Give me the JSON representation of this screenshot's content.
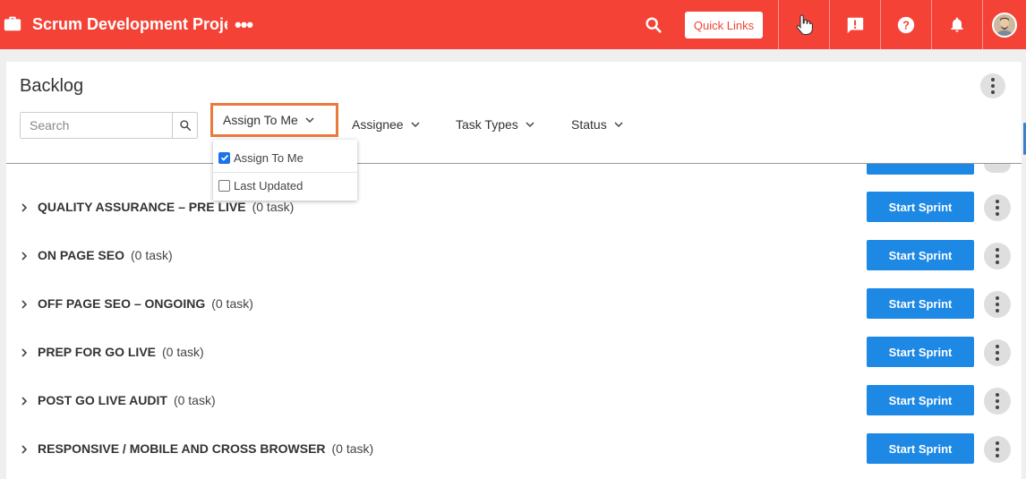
{
  "header": {
    "project_title": "Scrum Development Projec",
    "more": "•••",
    "quick_links": "Quick Links",
    "icons": [
      "briefcase-icon",
      "search-icon",
      "pointer-hand-icon",
      "feedback-icon",
      "help-icon",
      "bell-icon",
      "avatar"
    ]
  },
  "page": {
    "title": "Backlog"
  },
  "toolbar": {
    "search_placeholder": "Search",
    "filters": {
      "assign_to_me": "Assign To Me",
      "assignee": "Assignee",
      "task_types": "Task Types",
      "status": "Status"
    }
  },
  "dropdown": {
    "items": [
      {
        "label": "Assign To Me",
        "checked": true
      },
      {
        "label": "Last Updated",
        "checked": false
      }
    ]
  },
  "sprints": [
    {
      "name": "QUALITY ASSURANCE – PRE LIVE",
      "count": "(0 task)",
      "action": "Start Sprint"
    },
    {
      "name": "ON PAGE SEO",
      "count": "(0 task)",
      "action": "Start Sprint"
    },
    {
      "name": "OFF PAGE SEO – ONGOING",
      "count": "(0 task)",
      "action": "Start Sprint"
    },
    {
      "name": "PREP FOR GO LIVE",
      "count": "(0 task)",
      "action": "Start Sprint"
    },
    {
      "name": "POST GO LIVE AUDIT",
      "count": "(0 task)",
      "action": "Start Sprint"
    },
    {
      "name": "RESPONSIVE / MOBILE AND CROSS BROWSER",
      "count": "(0 task)",
      "action": "Start Sprint"
    }
  ],
  "colors": {
    "header": "#f44336",
    "primary_button": "#1e88e5",
    "highlight_border": "#e87b3c"
  }
}
